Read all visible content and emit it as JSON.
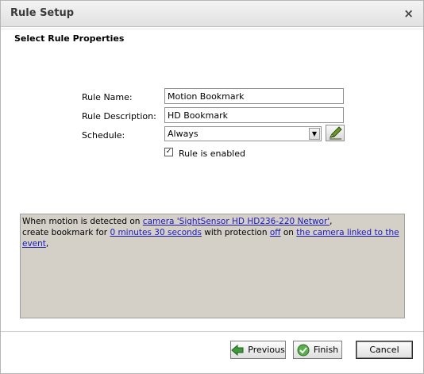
{
  "window": {
    "title": "Rule Setup",
    "close_label": "×"
  },
  "section": {
    "heading": "Select Rule Properties"
  },
  "form": {
    "rule_name_label": "Rule Name:",
    "rule_name_value": "Motion Bookmark",
    "rule_description_label": "Rule Description:",
    "rule_description_value": "HD Bookmark",
    "schedule_label": "Schedule:",
    "schedule_value": "Always",
    "enabled_label": "Rule is enabled",
    "enabled_checked": true
  },
  "summary": {
    "line1_prefix": "When motion is detected on ",
    "camera_link": "camera 'SightSensor HD HD236-220 Networ'",
    "line1_suffix": ",",
    "line2_prefix": "create bookmark for ",
    "duration_link": "0 minutes 30 seconds",
    "line2_mid1": " with protection ",
    "protection_link": "off",
    "line2_mid2": " on ",
    "target_link": "the camera linked to the event",
    "line2_suffix": ","
  },
  "buttons": {
    "previous": "Previous",
    "finish": "Finish",
    "cancel": "Cancel"
  },
  "icons": {
    "close": "close-icon",
    "dropdown": "chevron-down-icon",
    "edit": "pencil-icon",
    "previous": "arrow-left-icon",
    "finish": "check-circle-icon"
  }
}
